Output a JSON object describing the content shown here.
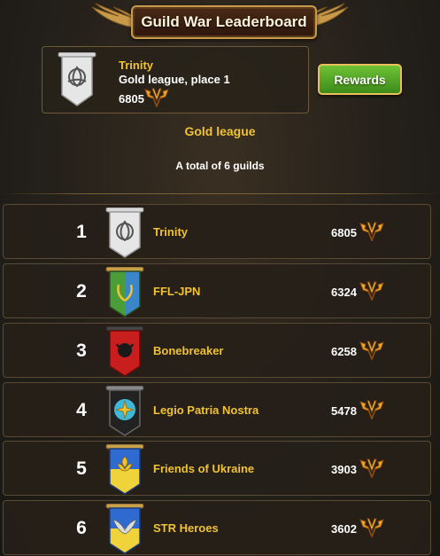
{
  "header": {
    "title": "Guild War Leaderboard"
  },
  "my_guild": {
    "name": "Trinity",
    "league_place": "Gold league, place 1",
    "score": "6805",
    "banner": "white-triquetra-banner"
  },
  "rewards_label": "Rewards",
  "league_title": "Gold league",
  "guild_count": "A total of 6 guilds",
  "rows": [
    {
      "rank": "1",
      "name": "Trinity",
      "score": "6805",
      "banner": "white-triquetra-banner",
      "colors": [
        "#e8e8e8",
        "#b5b5b5"
      ]
    },
    {
      "rank": "2",
      "name": "FFL-JPN",
      "score": "6324",
      "banner": "blue-green-laurel-banner",
      "colors": [
        "#4a9e3a",
        "#3a86c8"
      ]
    },
    {
      "rank": "3",
      "name": "Bonebreaker",
      "score": "6258",
      "banner": "red-bull-banner",
      "colors": [
        "#c81e1e",
        "#8a1010"
      ]
    },
    {
      "rank": "4",
      "name": "Legio Patria Nostra",
      "score": "5478",
      "banner": "black-sun-banner",
      "colors": [
        "#222222",
        "#3fb8d8"
      ]
    },
    {
      "rank": "5",
      "name": "Friends of Ukraine",
      "score": "3903",
      "banner": "blue-yellow-fleur-banner",
      "colors": [
        "#2f6ad0",
        "#f0d23a"
      ]
    },
    {
      "rank": "6",
      "name": "STR Heroes",
      "score": "3602",
      "banner": "blue-yellow-wings-banner",
      "colors": [
        "#2f6ad0",
        "#f0d23a"
      ]
    }
  ],
  "icons": {
    "score_emblem": "winged-v-emblem-icon",
    "title_wings": "golden-wings-icon"
  },
  "theme": {
    "gold_text": "#f1c232",
    "button_green": "#4ea526"
  }
}
